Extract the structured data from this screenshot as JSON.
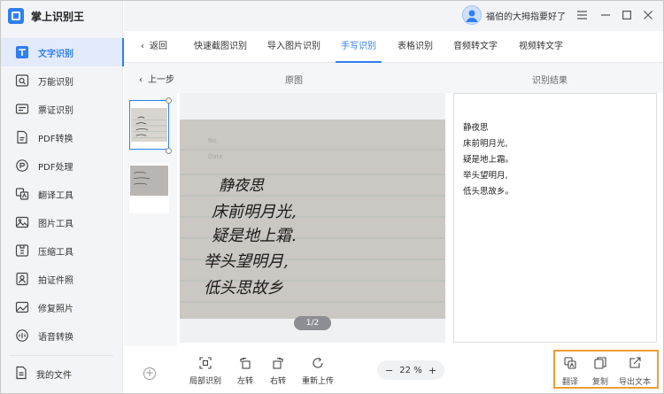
{
  "app": {
    "title": "掌上识别王"
  },
  "user": {
    "name": "福伯的大拇指要好了"
  },
  "sidebar": {
    "items": [
      {
        "label": "文字识别",
        "icon": "text-recognition-icon",
        "active": true
      },
      {
        "label": "万能识别",
        "icon": "universal-scan-icon"
      },
      {
        "label": "票证识别",
        "icon": "ticket-icon"
      },
      {
        "label": "PDF转换",
        "icon": "pdf-convert-icon"
      },
      {
        "label": "PDF处理",
        "icon": "pdf-process-icon"
      },
      {
        "label": "翻译工具",
        "icon": "translate-icon"
      },
      {
        "label": "图片工具",
        "icon": "image-icon"
      },
      {
        "label": "压缩工具",
        "icon": "compress-icon"
      },
      {
        "label": "拍证件照",
        "icon": "id-photo-icon"
      },
      {
        "label": "修复照片",
        "icon": "repair-photo-icon"
      },
      {
        "label": "语音转换",
        "icon": "voice-icon"
      }
    ],
    "my_files": "我的文件"
  },
  "tabs": {
    "back": "返回",
    "items": [
      "快速截图识别",
      "导入图片识别",
      "手写识别",
      "表格识别",
      "音频转文字",
      "视频转文字"
    ],
    "active": "手写识别"
  },
  "subheader": {
    "prev": "上一步",
    "original": "原图",
    "result": "识别结果"
  },
  "viewer": {
    "pager": "1/2"
  },
  "result": {
    "lines": [
      "静夜思",
      "床前明月光,",
      "疑是地上霜。",
      "举头望明月,",
      "低头思故乡。"
    ]
  },
  "toolbar": {
    "tools": [
      "局部识别",
      "左转",
      "右转",
      "重新上传"
    ],
    "zoom": "22 %",
    "zoom_out": "−",
    "zoom_in": "+"
  },
  "actions": {
    "translate": "翻译",
    "copy": "复制",
    "export": "导出文本"
  },
  "handwriting": [
    "静夜思",
    "床前明月光,",
    "疑是地上霜.",
    "举头望明月,",
    "低头思故乡"
  ],
  "colors": {
    "accent": "#2f7ff0",
    "highlight": "#f39c34"
  }
}
